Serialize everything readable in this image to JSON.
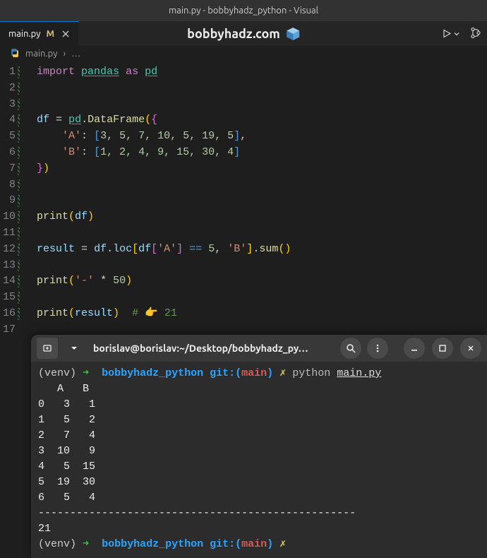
{
  "window_title": "main.py - bobbyhadz_python - Visual",
  "tab": {
    "name": "main.py",
    "modified_badge": "M"
  },
  "center_url": "bobbyhadz.com",
  "breadcrumb": {
    "file": "main.py",
    "more": "…"
  },
  "gutter_lines": [
    "1",
    "2",
    "3",
    "4",
    "5",
    "6",
    "7",
    "8",
    "9",
    "10",
    "11",
    "12",
    "13",
    "14",
    "15",
    "16",
    "17"
  ],
  "code": {
    "l1": {
      "import": "import",
      "pandas": "pandas",
      "as": "as",
      "pd": "pd"
    },
    "l4": {
      "df": "df",
      "eq": "=",
      "pd": "pd",
      "dot": ".",
      "DataFrame": "DataFrame",
      "lp": "(",
      "lb": "{"
    },
    "l5": {
      "key": "'A'",
      "colon": ":",
      "lb": "[",
      "nums": "3, 5, 7, 10, 5, 19, 5",
      "rb": "]",
      "comma": ","
    },
    "l6": {
      "key": "'B'",
      "colon": ":",
      "lb": "[",
      "nums": "1, 2, 4, 9, 15, 30, 4",
      "rb": "]"
    },
    "l7": {
      "rb": "}",
      "rp": ")"
    },
    "l10": {
      "print": "print",
      "lp": "(",
      "df": "df",
      "rp": ")"
    },
    "l12": {
      "result": "result",
      "eq": "=",
      "df": "df",
      "dot1": ".",
      "loc": "loc",
      "lb": "[",
      "df2": "df",
      "lb2": "[",
      "key": "'A'",
      "rb2": "]",
      "cmp": "==",
      "five": "5",
      "comma": ",",
      "keyB": "'B'",
      "rb": "]",
      "dot2": ".",
      "sum": "sum",
      "lp": "(",
      "rp": ")"
    },
    "l14": {
      "print": "print",
      "lp": "(",
      "dash": "'-'",
      "star": "*",
      "fifty": "50",
      "rp": ")"
    },
    "l16": {
      "print": "print",
      "lp": "(",
      "result": "result",
      "rp": ")",
      "hash": "#",
      "emoji": "👉",
      "val": "21"
    }
  },
  "terminal": {
    "title": "borislav@borislav:~/Desktop/bobbyhadz_py…",
    "prompt": {
      "venv": "(venv)",
      "arrow": "➜",
      "dir": "bobbyhadz_python",
      "git": "git:",
      "lparen": "(",
      "branch": "main",
      "rparen": ")",
      "x": "✗",
      "cmd": "python",
      "file": "main.py"
    },
    "output_lines": [
      "   A   B",
      "0   3   1",
      "1   5   2",
      "2   7   4",
      "3  10   9",
      "4   5  15",
      "5  19  30",
      "6   5   4",
      "--------------------------------------------------",
      "21"
    ]
  }
}
